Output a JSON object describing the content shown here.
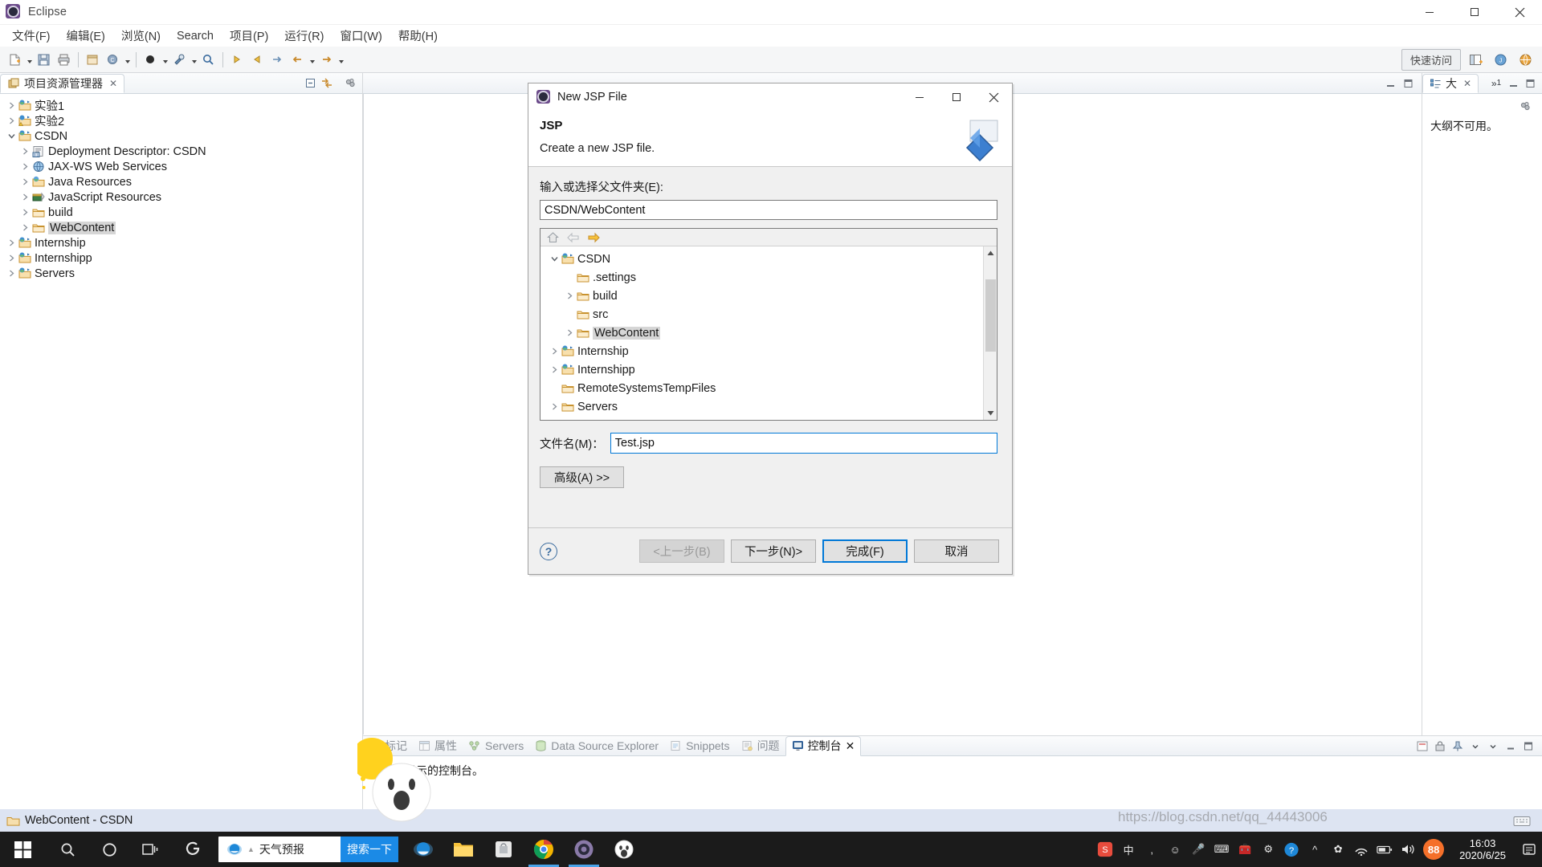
{
  "window": {
    "title": "Eclipse",
    "controls": {
      "minimize": "minimize-icon",
      "maximize": "maximize-icon",
      "close": "close-icon"
    }
  },
  "menubar": {
    "items": [
      {
        "label": "文件(F)",
        "name": "menu-file"
      },
      {
        "label": "编辑(E)",
        "name": "menu-edit"
      },
      {
        "label": "浏览(N)",
        "name": "menu-navigate"
      },
      {
        "label": "Search",
        "name": "menu-search"
      },
      {
        "label": "项目(P)",
        "name": "menu-project"
      },
      {
        "label": "运行(R)",
        "name": "menu-run"
      },
      {
        "label": "窗口(W)",
        "name": "menu-window"
      },
      {
        "label": "帮助(H)",
        "name": "menu-help"
      }
    ]
  },
  "toolbar": {
    "quick_access": "快速访问",
    "perspective_open": "open-perspective-icon",
    "perspective_java_ee": "java-ee-perspective-icon",
    "perspective_web": "web-perspective-icon"
  },
  "explorer": {
    "tab_label": "项目资源管理器",
    "tab_close": "✕",
    "tools": [
      "collapse-all-icon",
      "link-with-editor-icon",
      "view-menu-icon"
    ],
    "tree": [
      {
        "label": "实验1",
        "icon": "project-icon",
        "indent": 0,
        "twist": "collapsed",
        "selected": false
      },
      {
        "label": "实验2",
        "icon": "project-warn-icon",
        "indent": 0,
        "twist": "collapsed",
        "selected": false
      },
      {
        "label": "CSDN",
        "icon": "project-icon",
        "indent": 0,
        "twist": "expanded",
        "selected": false
      },
      {
        "label": "Deployment Descriptor: CSDN",
        "icon": "deployment-descriptor-icon",
        "indent": 1,
        "twist": "collapsed",
        "selected": false
      },
      {
        "label": "JAX-WS Web Services",
        "icon": "jaxws-icon",
        "indent": 1,
        "twist": "collapsed",
        "selected": false
      },
      {
        "label": "Java Resources",
        "icon": "java-resources-icon",
        "indent": 1,
        "twist": "collapsed",
        "selected": false
      },
      {
        "label": "JavaScript Resources",
        "icon": "js-resources-icon",
        "indent": 1,
        "twist": "collapsed",
        "selected": false
      },
      {
        "label": "build",
        "icon": "folder-icon",
        "indent": 1,
        "twist": "collapsed",
        "selected": false
      },
      {
        "label": "WebContent",
        "icon": "folder-icon",
        "indent": 1,
        "twist": "collapsed",
        "selected": true
      },
      {
        "label": "Internship",
        "icon": "project-icon",
        "indent": 0,
        "twist": "collapsed",
        "selected": false
      },
      {
        "label": "Internshipp",
        "icon": "project-icon",
        "indent": 0,
        "twist": "collapsed",
        "selected": false
      },
      {
        "label": "Servers",
        "icon": "project-icon",
        "indent": 0,
        "twist": "collapsed",
        "selected": false
      }
    ]
  },
  "outline": {
    "tab_label": "大",
    "overflow_count": "1",
    "message": "大纲不可用。",
    "tools": [
      "view-menu-icon"
    ]
  },
  "bottom_panel": {
    "tabs": [
      {
        "label": "标记",
        "icon": "markers-icon",
        "active": false
      },
      {
        "label": "属性",
        "icon": "properties-icon",
        "active": false
      },
      {
        "label": "Servers",
        "icon": "servers-icon",
        "active": false
      },
      {
        "label": "Data Source Explorer",
        "icon": "datasource-icon",
        "active": false
      },
      {
        "label": "Snippets",
        "icon": "snippets-icon",
        "active": false
      },
      {
        "label": "问题",
        "icon": "problems-icon",
        "active": false
      },
      {
        "label": "控制台",
        "icon": "console-icon",
        "active": true
      }
    ],
    "tab_close": "✕",
    "content": "没有要显示的控制台。"
  },
  "statusbar": {
    "left_icon": "folder-icon",
    "left_text": "WebContent - CSDN",
    "right_icon": "keyboard-icon"
  },
  "dialog": {
    "title": "New JSP File",
    "title_icon": "eclipse-icon",
    "heading": "JSP",
    "subheading": "Create a new JSP file.",
    "banner_icon": "jsp-wizard-banner-icon",
    "parent_folder_label": "输入或选择父文件夹(E):",
    "parent_folder_value": "CSDN/WebContent",
    "tree_toolbar": [
      "home-icon",
      "back-icon",
      "forward-icon"
    ],
    "folder_tree": [
      {
        "label": "CSDN",
        "icon": "project-icon",
        "indent": 0,
        "twist": "expanded",
        "selected": false
      },
      {
        "label": ".settings",
        "icon": "folder-icon",
        "indent": 1,
        "twist": "none",
        "selected": false
      },
      {
        "label": "build",
        "icon": "folder-icon",
        "indent": 1,
        "twist": "collapsed",
        "selected": false
      },
      {
        "label": "src",
        "icon": "folder-icon",
        "indent": 1,
        "twist": "none",
        "selected": false
      },
      {
        "label": "WebContent",
        "icon": "folder-icon",
        "indent": 1,
        "twist": "collapsed",
        "selected": true
      },
      {
        "label": "Internship",
        "icon": "project-icon",
        "indent": 0,
        "twist": "collapsed",
        "selected": false
      },
      {
        "label": "Internshipp",
        "icon": "project-icon",
        "indent": 0,
        "twist": "collapsed",
        "selected": false
      },
      {
        "label": "RemoteSystemsTempFiles",
        "icon": "folder-icon",
        "indent": 0,
        "twist": "none",
        "selected": false
      },
      {
        "label": "Servers",
        "icon": "folder-icon",
        "indent": 0,
        "twist": "collapsed",
        "selected": false
      }
    ],
    "filename_label": "文件名(M)：",
    "filename_value": "Test.jsp",
    "advanced_button": "高级(A) >>",
    "help_button": "?",
    "buttons": {
      "back": "<上一步(B)",
      "next": "下一步(N)>",
      "finish": "完成(F)",
      "cancel": "取消"
    }
  },
  "taskbar": {
    "start": "windows-start-icon",
    "search": "search-icon",
    "cortana": "cortana-icon",
    "taskview": "task-view-icon",
    "sogou_pinned": "sogou-icon",
    "widget": {
      "browser_icon": "internet-explorer-icon",
      "text": "天气预报",
      "button": "搜索一下"
    },
    "apps": [
      {
        "name": "internet-explorer",
        "active": false
      },
      {
        "name": "file-explorer",
        "active": false
      },
      {
        "name": "microsoft-store",
        "active": false
      },
      {
        "name": "chrome",
        "active": true
      },
      {
        "name": "eclipse",
        "active": true
      },
      {
        "name": "emoji-app",
        "active": false
      }
    ],
    "tray": {
      "sogou": "S",
      "help": "?",
      "chevron": "^",
      "flower": "flower-icon",
      "network": "network-icon",
      "battery": "battery-icon",
      "volume": "volume-icon",
      "badge": "88"
    },
    "clock_time": "16:03",
    "clock_date": "2020/6/25",
    "notification": "notification-icon"
  },
  "watermark": "https://blog.csdn.net/qq_44443006"
}
